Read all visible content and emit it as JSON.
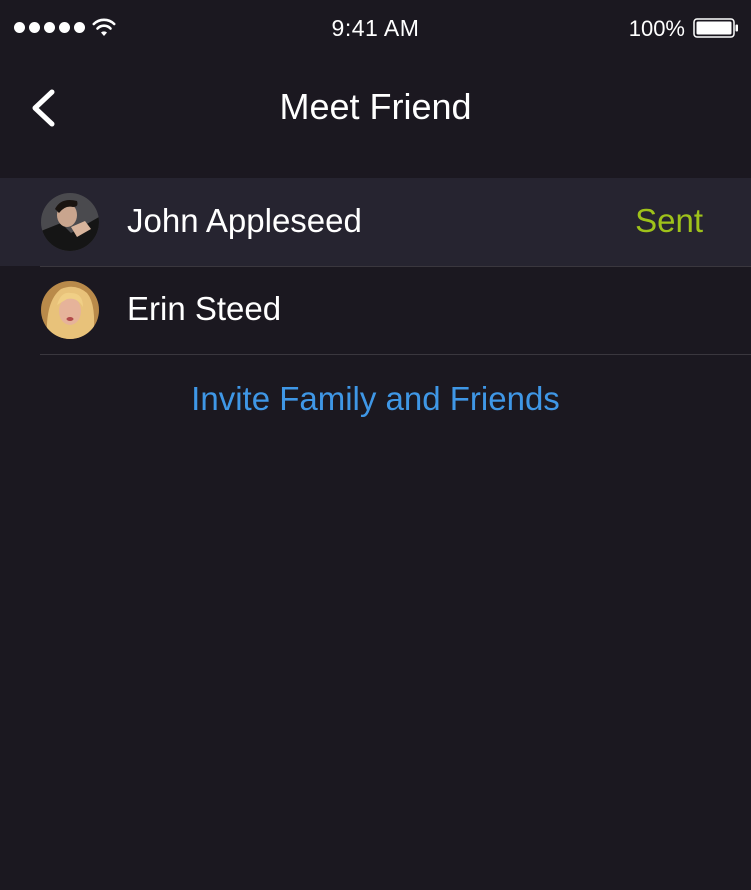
{
  "status_bar": {
    "time": "9:41 AM",
    "battery_percent": "100%",
    "signal_bars": 5,
    "battery_level": 1.0
  },
  "nav": {
    "title": "Meet Friend",
    "back_icon": "chevron-left-icon"
  },
  "friends": [
    {
      "name": "John Appleseed",
      "status": "Sent",
      "highlighted": true
    },
    {
      "name": "Erin Steed",
      "status": "",
      "highlighted": false
    }
  ],
  "invite": {
    "label": "Invite Family and Friends"
  },
  "colors": {
    "background": "#1b1820",
    "row_highlight": "#262430",
    "sent": "#9fc21a",
    "link": "#3f97e6",
    "separator": "#3a373e"
  }
}
